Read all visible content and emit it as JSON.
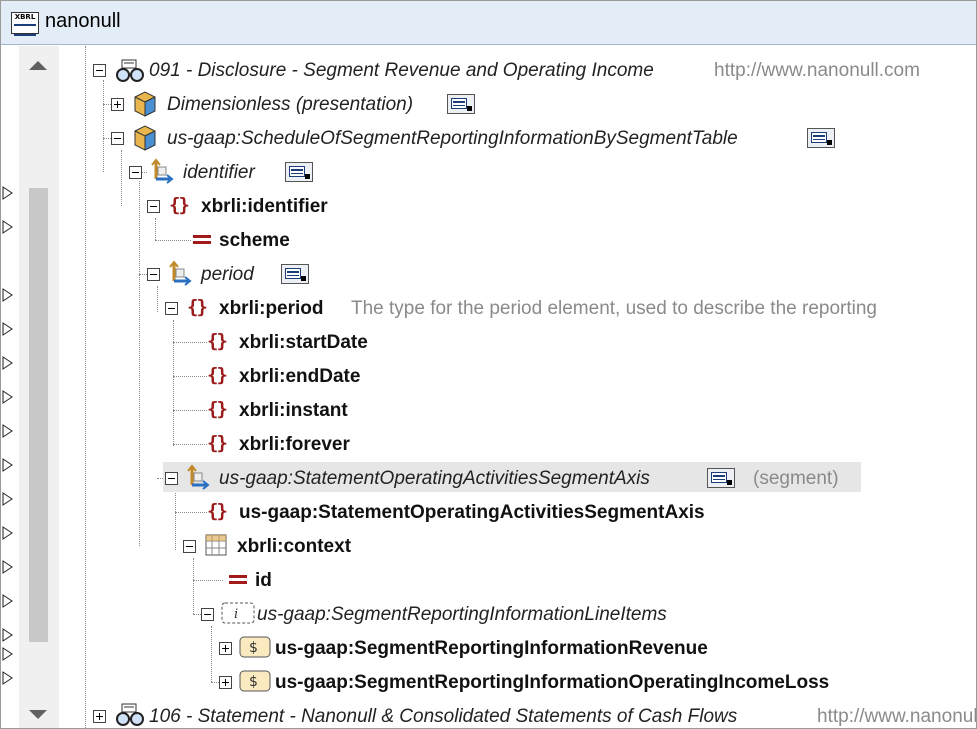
{
  "window": {
    "title": "nanonull"
  },
  "tree": {
    "n1_label": "091 - Disclosure - Segment Revenue and Operating Income",
    "n1_url": "http://www.nanonull.com",
    "n2_label": "Dimensionless (presentation)",
    "n3_label": "us-gaap:ScheduleOfSegmentReportingInformationBySegmentTable",
    "n4_label": "identifier",
    "n5_label": "xbrli:identifier",
    "n6_label": "scheme",
    "n7_label": "period",
    "n8_label": "xbrli:period",
    "n8_desc": "The type for the period element, used to describe the reporting",
    "n9_label": "xbrli:startDate",
    "n10_label": "xbrli:endDate",
    "n11_label": "xbrli:instant",
    "n12_label": "xbrli:forever",
    "n13_label": "us-gaap:StatementOperatingActivitiesSegmentAxis",
    "n13_desc": "(segment)",
    "n14_label": "us-gaap:StatementOperatingActivitiesSegmentAxis",
    "n15_label": "xbrli:context",
    "n16_label": "id",
    "n17_label": "us-gaap:SegmentReportingInformationLineItems",
    "n18_label": "us-gaap:SegmentReportingInformationRevenue",
    "n19_label": "us-gaap:SegmentReportingInformationOperatingIncomeLoss",
    "n20_label": "106 - Statement - Nanonull & Consolidated Statements of Cash Flows",
    "n20_url": "http://www.nanonull.com"
  },
  "icons": {
    "title": "xbrl-taxonomy-icon",
    "linkrole": "linkrole-glasses-icon",
    "hypercube": "hypercube-icon",
    "dimension": "dimension-axis-icon",
    "element": "element-braces-icon",
    "attribute": "attribute-equals-icon",
    "context": "context-grid-icon",
    "lineitems": "line-items-icon",
    "monetary": "monetary-item-icon",
    "presentation": "presentation-toggle-icon"
  },
  "colors": {
    "element_brace": "#9a1c1c",
    "attribute": "#a31a1a",
    "titlebar": "#e3edf8",
    "selection": "#e6e6e6"
  }
}
